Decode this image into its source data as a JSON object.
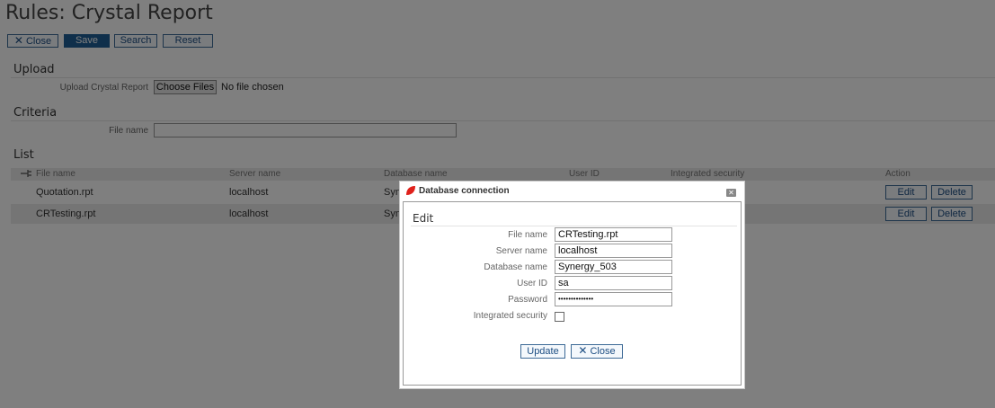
{
  "page": {
    "title": "Rules: Crystal Report"
  },
  "toolbar": {
    "close_label": "Close",
    "save_label": "Save",
    "search_label": "Search",
    "reset_label": "Reset"
  },
  "upload": {
    "section_title": "Upload",
    "field_label": "Upload Crystal Report",
    "choose_label": "Choose Files",
    "status": "No file chosen"
  },
  "criteria": {
    "section_title": "Criteria",
    "file_name_label": "File name",
    "file_name_value": ""
  },
  "list": {
    "section_title": "List",
    "columns": [
      "File name",
      "Server name",
      "Database name",
      "User ID",
      "Integrated security",
      "Action"
    ],
    "rows": [
      {
        "file_name": "Quotation.rpt",
        "server_name": "localhost",
        "database_name": "Syn"
      },
      {
        "file_name": "CRTesting.rpt",
        "server_name": "localhost",
        "database_name": "Syn"
      }
    ],
    "edit_label": "Edit",
    "delete_label": "Delete"
  },
  "dialog": {
    "title": "Database connection",
    "section_title": "Edit",
    "fields": {
      "file_name": {
        "label": "File name",
        "value": "CRTesting.rpt"
      },
      "server_name": {
        "label": "Server name",
        "value": "localhost"
      },
      "database_name": {
        "label": "Database name",
        "value": "Synergy_503"
      },
      "user_id": {
        "label": "User ID",
        "value": "sa"
      },
      "password": {
        "label": "Password",
        "value": "••••••••••••••"
      },
      "integrated_security": {
        "label": "Integrated security",
        "checked": false
      }
    },
    "update_label": "Update",
    "close_label": "Close"
  },
  "colors": {
    "primary_button": "#1f5e97",
    "button_border": "#3d6a96",
    "overlay": "rgba(0,0,0,0.5)",
    "logo_red": "#e0211b"
  }
}
